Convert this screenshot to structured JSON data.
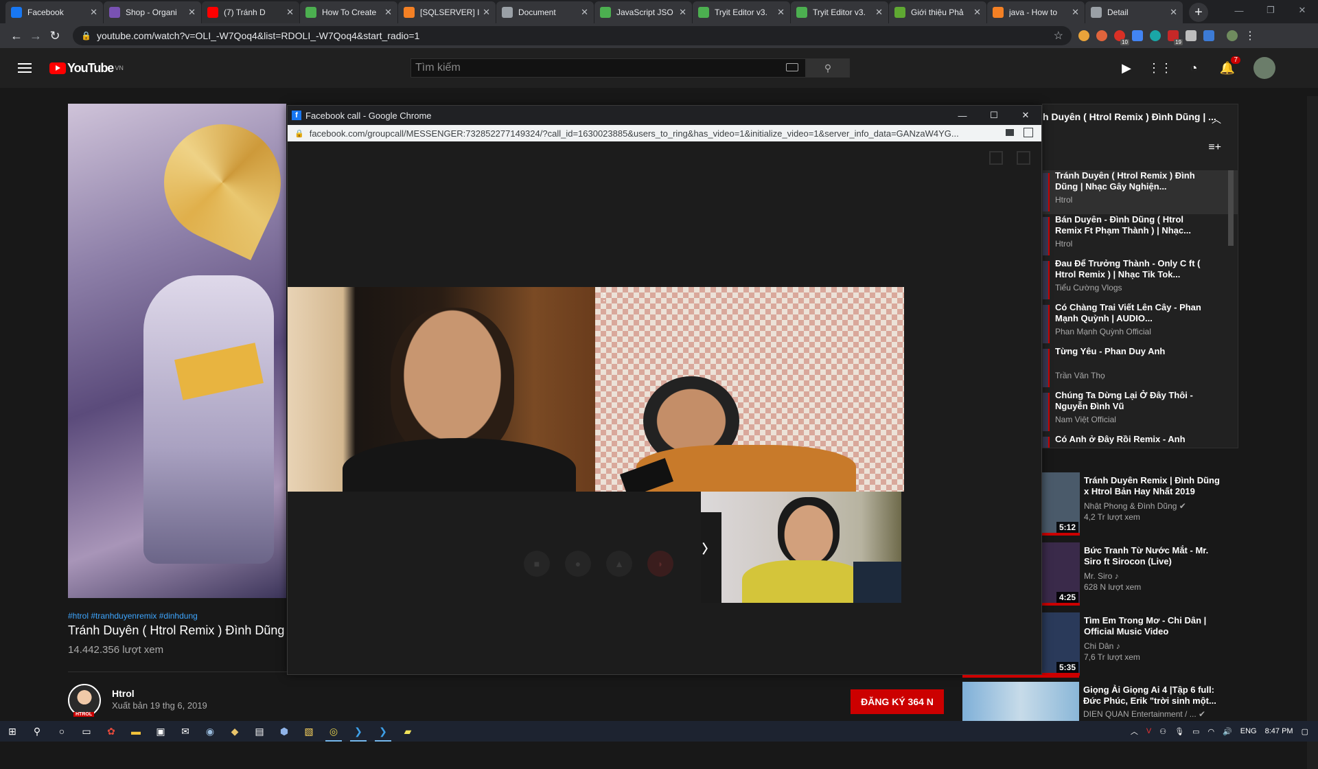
{
  "browser": {
    "tabs": [
      {
        "title": "Facebook",
        "icon": "facebook-icon",
        "color": "#1877f2"
      },
      {
        "title": "Shop - Organi",
        "icon": "bootstrap-icon",
        "color": "#7952b3"
      },
      {
        "title": "(7) Tránh D",
        "icon": "youtube-icon",
        "color": "#ff0000"
      },
      {
        "title": "How To Create",
        "icon": "w3schools-icon",
        "color": "#4caf50"
      },
      {
        "title": "[SQLSERVER] I",
        "icon": "stackoverflow-icon",
        "color": "#f48024"
      },
      {
        "title": "Document",
        "icon": "globe-icon",
        "color": "#9aa0a6"
      },
      {
        "title": "JavaScript JSO",
        "icon": "w3schools-icon",
        "color": "#4caf50"
      },
      {
        "title": "Tryit Editor v3.",
        "icon": "w3schools-icon",
        "color": "#4caf50"
      },
      {
        "title": "Tryit Editor v3.",
        "icon": "w3schools-icon",
        "color": "#4caf50"
      },
      {
        "title": "Giới thiệu Phả",
        "icon": "leaf-icon",
        "color": "#5fa832"
      },
      {
        "title": "java - How to",
        "icon": "stackoverflow-icon",
        "color": "#f48024"
      },
      {
        "title": "Detail",
        "icon": "globe-icon",
        "color": "#9aa0a6"
      }
    ],
    "url": "youtube.com/watch?v=OLI_-W7Qoq4&list=RDOLI_-W7Qoq4&start_radio=1",
    "extension_counts": [
      "10",
      "19"
    ]
  },
  "youtube": {
    "logo": "YouTube",
    "region": "VN",
    "search_placeholder": "Tìm kiếm",
    "notification_count": "7",
    "video": {
      "tags": "#htrol #tranhduyenremix #dinhdung",
      "title": "Tránh Duyên ( Htrol Remix ) Đình Dũng |",
      "views": "14.442.356 lượt xem",
      "channel": "Htrol",
      "channel_tag": "HTROL",
      "published": "Xuất bản 19 thg 6, 2019",
      "subscribe_label": "ĐĂNG KÝ  364 N"
    },
    "playlist": {
      "title": "h Duyên ( Htrol Remix ) Đình Dũng | ...",
      "items": [
        {
          "title": "Tránh Duyên ( Htrol Remix ) Đình Dũng | Nhạc Gây Nghiện...",
          "channel": "Htrol"
        },
        {
          "title": "Bán Duyên - Đình Dũng ( Htrol Remix Ft Phạm Thành ) | Nhạc...",
          "channel": "Htrol"
        },
        {
          "title": "Đau Để Trưởng Thành - Only C ft ( Htrol Remix ) | Nhạc Tik Tok...",
          "channel": "Tiểu Cường Vlogs"
        },
        {
          "title": "Có Chàng Trai Viết Lên Cây - Phan Mạnh Quỳnh | AUDIO...",
          "channel": "Phan Mạnh Quỳnh Official"
        },
        {
          "title": "Từng Yêu - Phan Duy Anh",
          "channel": "Trần Văn Thọ"
        },
        {
          "title": "Chúng Ta Dừng Lại Ở Đây Thôi - Nguyễn Đình Vũ",
          "channel": "Nam Việt Official"
        },
        {
          "title": "Có Anh ở Đây Rồi Remix - Anh",
          "channel": ""
        }
      ]
    },
    "recommended": [
      {
        "title": "Tránh Duyên Remix | Đình Dũng x Htrol Bản Hay Nhất 2019",
        "channel": "Nhật Phong & Đình Dũng ✔",
        "views": "4,2 Tr lượt xem",
        "duration": "5:12"
      },
      {
        "title": "Bức Tranh Từ Nước Mắt - Mr. Siro ft Sirocon (Live)",
        "channel": "Mr. Siro ♪",
        "views": "628 N lượt xem",
        "duration": "4:25"
      },
      {
        "title": "Tìm Em Trong Mơ - Chi Dân | Official Music Video",
        "channel": "Chi Dân ♪",
        "views": "7,6 Tr lượt xem",
        "duration": "5:35"
      }
    ],
    "last_card": {
      "title": "Giọng Ải Giọng Ai 4 |Tập 6 full: Đức Phúc, Erik \"trời sinh một...",
      "channel": "DIEN QUAN Entertainment / ... ✔"
    }
  },
  "popup": {
    "title": "Facebook call - Google Chrome",
    "url": "facebook.com/groupcall/MESSENGER:732852277149324/?call_id=1630023885&users_to_ring&has_video=1&initialize_video=1&server_info_data=GANzaW4YG..."
  },
  "taskbar": {
    "lang": "ENG",
    "time": "8:47 PM"
  }
}
